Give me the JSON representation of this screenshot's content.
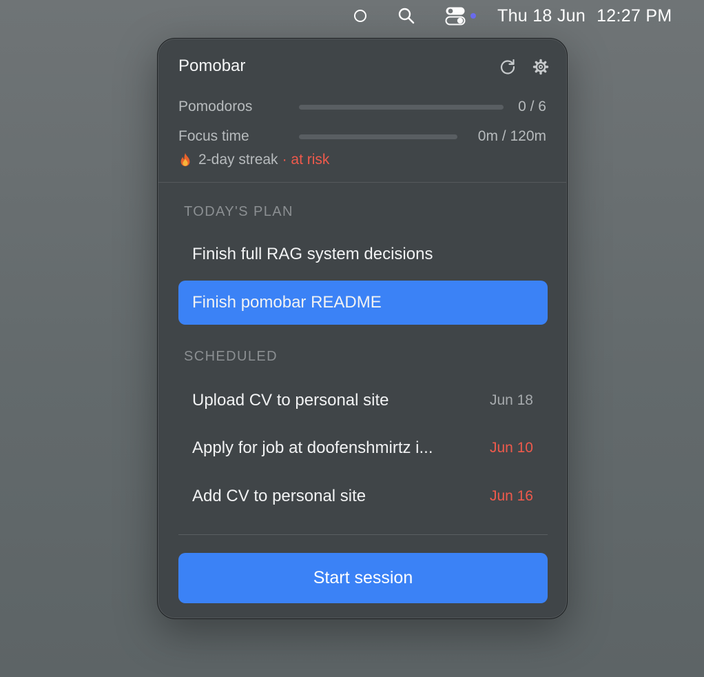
{
  "menubar": {
    "date": "Thu 18 Jun",
    "time": "12:27 PM",
    "icons": [
      "circle-icon",
      "search-icon",
      "control-center-icon"
    ]
  },
  "popover": {
    "title": "Pomobar",
    "stats": {
      "pomodoros": {
        "label": "Pomodoros",
        "value": "0 / 6",
        "progress": 0
      },
      "focus": {
        "label": "Focus time",
        "value": "0m / 120m",
        "progress": 0
      }
    },
    "streak": {
      "text": "2-day streak",
      "risk": "· at risk"
    },
    "plan": {
      "heading": "TODAY'S PLAN",
      "items": [
        {
          "title": "Finish full RAG system decisions"
        },
        {
          "title": "Finish pomobar README",
          "selected": true
        }
      ]
    },
    "scheduled": {
      "heading": "SCHEDULED",
      "items": [
        {
          "title": "Upload CV to personal site",
          "date": "Jun 18"
        },
        {
          "title": "Apply for job at doofenshmirtz i...",
          "date": "Jun 10",
          "overdue": true
        },
        {
          "title": "Add CV to personal site",
          "date": "Jun 16",
          "overdue": true
        }
      ]
    },
    "start_label": "Start session"
  },
  "colors": {
    "accent": "#3b82f6",
    "danger": "#ef5a4c",
    "panel": "#404548",
    "control_center_dot": "#6b6cf0"
  }
}
